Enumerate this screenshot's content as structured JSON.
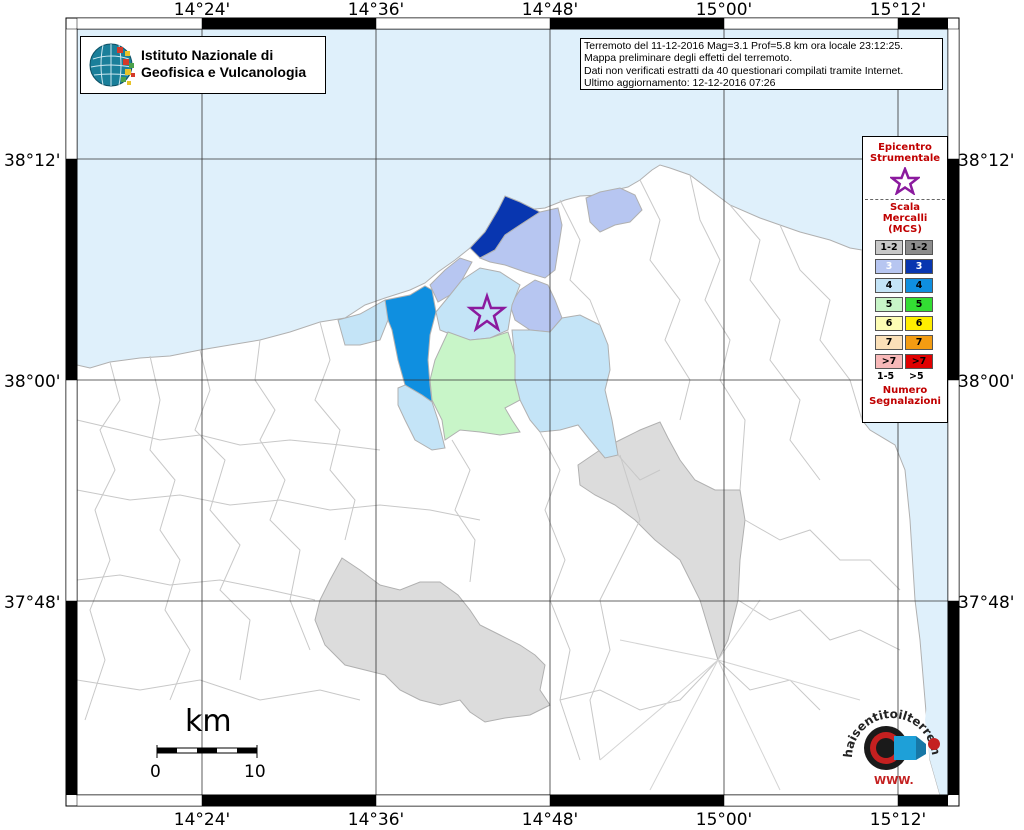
{
  "map": {
    "lon_labels_top": [
      "14°24'",
      "14°36'",
      "14°48'",
      "15°00'",
      "15°12'"
    ],
    "lon_labels_bottom": [
      "14°24'",
      "14°36'",
      "14°48'",
      "15°00'",
      "15°12'"
    ],
    "lat_labels_left": [
      "38°12'",
      "38°00'",
      "37°48'"
    ],
    "lat_labels_right": [
      "38°12'",
      "38°00'",
      "37°48'"
    ],
    "colors": {
      "sea": "#dff0fb",
      "land": "#ffffff",
      "border": "#cccccc",
      "mcs_3_light": "#b7c6f1",
      "mcs_3_dark": "#0836b0",
      "mcs_4_light": "#c4e4f7",
      "mcs_4_dark": "#0f8fe0",
      "mcs_5_light": "#c8f5c8",
      "no_data": "#dcdcdc",
      "epicenter": "#8b1a9e"
    }
  },
  "institute": {
    "line1": "Istituto Nazionale di",
    "line2": "Geofisica e Vulcanologia"
  },
  "info": {
    "line1": "Terremoto del 11-12-2016 Mag=3.1 Prof=5.8 km ora locale 23:12:25.",
    "line2": "Mappa preliminare degli effetti del terremoto.",
    "line3": "Dati non verificati estratti da 40 questionari compilati tramite Internet.",
    "line4": "Ultimo aggiornamento: 12-12-2016 07:26"
  },
  "legend": {
    "epicentro": "Epicentro",
    "strumentale": "Strumentale",
    "scala": "Scala",
    "mercalli": "Mercalli",
    "mcs": "(MCS)",
    "rows": [
      {
        "left": "1-2",
        "right": "1-2",
        "lc": "#c8c8c8",
        "rc": "#8c8c8c",
        "ltc": "#000000",
        "rtc": "#000000"
      },
      {
        "left": "3",
        "right": "3",
        "lc": "#b7c6f1",
        "rc": "#0836b0",
        "ltc": "#ffffff",
        "rtc": "#ffffff"
      },
      {
        "left": "4",
        "right": "4",
        "lc": "#c4e4f7",
        "rc": "#0f8fe0",
        "ltc": "#000000",
        "rtc": "#000000"
      },
      {
        "left": "5",
        "right": "5",
        "lc": "#c8f5c8",
        "rc": "#33dd33",
        "ltc": "#000000",
        "rtc": "#000000"
      },
      {
        "left": "6",
        "right": "6",
        "lc": "#fdfdb4",
        "rc": "#ffee00",
        "ltc": "#000000",
        "rtc": "#000000"
      },
      {
        "left": "7",
        "right": "7",
        "lc": "#fbe0b8",
        "rc": "#f39c12",
        "ltc": "#000000",
        "rtc": "#000000"
      },
      {
        "left": ">7",
        "right": ">7",
        "lc": "#f8b8b8",
        "rc": "#e00000",
        "ltc": "#000000",
        "rtc": "#000000"
      }
    ],
    "count_left": "1-5",
    "count_right": ">5",
    "numero": "Numero",
    "segnalazioni": "Segnalazioni"
  },
  "scale": {
    "unit": "km",
    "zero": "0",
    "ten": "10"
  },
  "badge": {
    "text": "haisentitoilterremoto.it",
    "www": "WWW."
  }
}
